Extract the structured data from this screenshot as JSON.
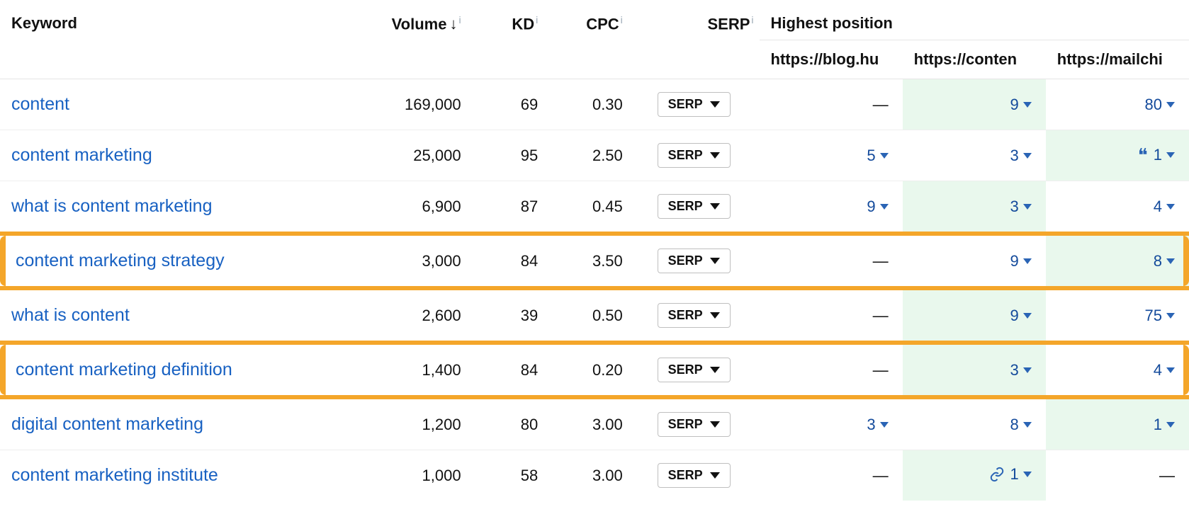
{
  "columns": {
    "keyword": "Keyword",
    "volume": "Volume",
    "volume_sort": "↓",
    "kd": "KD",
    "cpc": "CPC",
    "serp": "SERP",
    "highest_position": "Highest position",
    "info_glyph": "i",
    "sites": [
      "https://blog.hu",
      "https://conten",
      "https://mailchi"
    ]
  },
  "serp_button_label": "SERP",
  "dash": "—",
  "rows": [
    {
      "keyword": "content",
      "volume": "169,000",
      "kd": "69",
      "cpc": "0.30",
      "hl": false,
      "col_green": [
        false,
        true,
        false
      ],
      "positions": [
        {
          "value": "—",
          "caret": false
        },
        {
          "value": "9",
          "caret": true
        },
        {
          "value": "80",
          "caret": true
        }
      ]
    },
    {
      "keyword": "content marketing",
      "volume": "25,000",
      "kd": "95",
      "cpc": "2.50",
      "hl": false,
      "col_green": [
        false,
        false,
        true
      ],
      "positions": [
        {
          "value": "5",
          "caret": true
        },
        {
          "value": "3",
          "caret": true
        },
        {
          "value": "1",
          "caret": true,
          "quote": true
        }
      ]
    },
    {
      "keyword": "what is content marketing",
      "volume": "6,900",
      "kd": "87",
      "cpc": "0.45",
      "hl": false,
      "col_green": [
        false,
        true,
        false
      ],
      "positions": [
        {
          "value": "9",
          "caret": true
        },
        {
          "value": "3",
          "caret": true
        },
        {
          "value": "4",
          "caret": true
        }
      ]
    },
    {
      "keyword": "content marketing strategy",
      "volume": "3,000",
      "kd": "84",
      "cpc": "3.50",
      "hl": true,
      "col_green": [
        false,
        false,
        true
      ],
      "positions": [
        {
          "value": "—",
          "caret": false
        },
        {
          "value": "9",
          "caret": true
        },
        {
          "value": "8",
          "caret": true
        }
      ]
    },
    {
      "keyword": "what is content",
      "volume": "2,600",
      "kd": "39",
      "cpc": "0.50",
      "hl": false,
      "col_green": [
        false,
        true,
        false
      ],
      "positions": [
        {
          "value": "—",
          "caret": false
        },
        {
          "value": "9",
          "caret": true
        },
        {
          "value": "75",
          "caret": true
        }
      ]
    },
    {
      "keyword": "content marketing definition",
      "volume": "1,400",
      "kd": "84",
      "cpc": "0.20",
      "hl": true,
      "col_green": [
        false,
        true,
        false
      ],
      "positions": [
        {
          "value": "—",
          "caret": false
        },
        {
          "value": "3",
          "caret": true
        },
        {
          "value": "4",
          "caret": true
        }
      ]
    },
    {
      "keyword": "digital content marketing",
      "volume": "1,200",
      "kd": "80",
      "cpc": "3.00",
      "hl": false,
      "col_green": [
        false,
        false,
        true
      ],
      "positions": [
        {
          "value": "3",
          "caret": true
        },
        {
          "value": "8",
          "caret": true
        },
        {
          "value": "1",
          "caret": true
        }
      ]
    },
    {
      "keyword": "content marketing institute",
      "volume": "1,000",
      "kd": "58",
      "cpc": "3.00",
      "hl": false,
      "col_green": [
        false,
        true,
        false
      ],
      "positions": [
        {
          "value": "—",
          "caret": false
        },
        {
          "value": "1",
          "caret": true,
          "link": true
        },
        {
          "value": "—",
          "caret": false
        }
      ]
    }
  ]
}
